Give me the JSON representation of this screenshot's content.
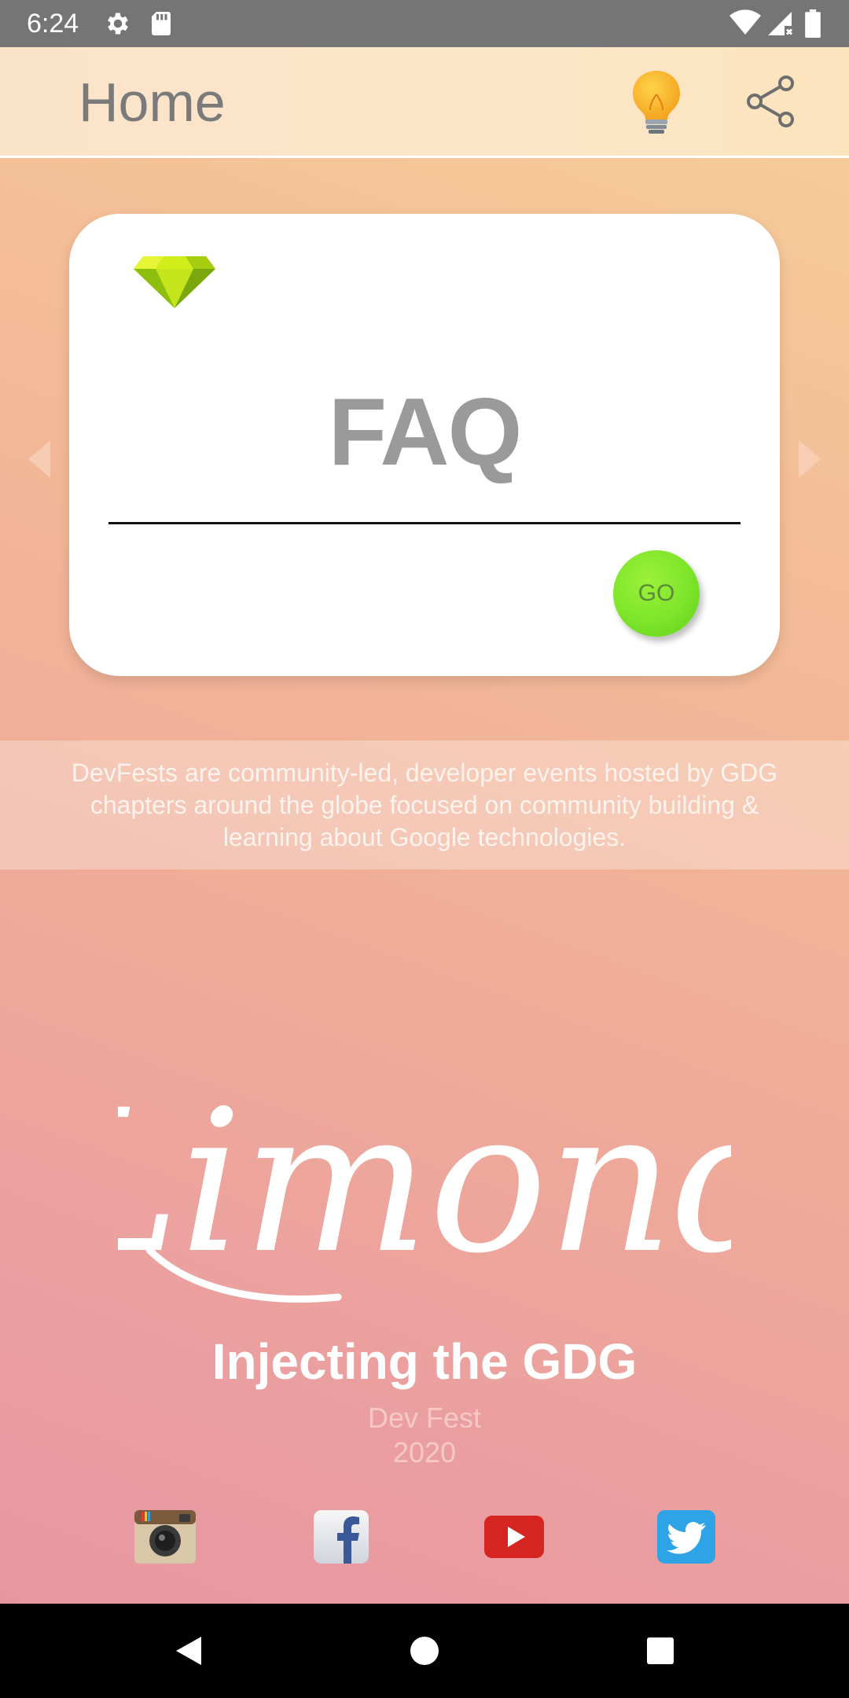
{
  "status_bar": {
    "time": "6:24",
    "icons": [
      "gear-icon",
      "sd-card-icon",
      "wifi-icon",
      "signal-icon",
      "battery-icon"
    ]
  },
  "app_bar": {
    "title": "Home",
    "actions": [
      "lightbulb-icon",
      "share-icon"
    ]
  },
  "card": {
    "title": "FAQ",
    "go_label": "GO",
    "badge_icon": "diamond-icon"
  },
  "info": {
    "text": "DevFests are community-led, developer events hosted by GDG chapters around the globe focused on community building & learning about Google technologies."
  },
  "branding": {
    "logo_text": "Limond",
    "tagline": "Injecting the GDG",
    "event_name": "Dev Fest",
    "year": "2020"
  },
  "social": [
    "instagram-icon",
    "facebook-icon",
    "youtube-icon",
    "twitter-icon"
  ],
  "colors": {
    "go_button": "#7de52a",
    "title_gray": "#9a9a9a",
    "status_bar": "#757575"
  }
}
